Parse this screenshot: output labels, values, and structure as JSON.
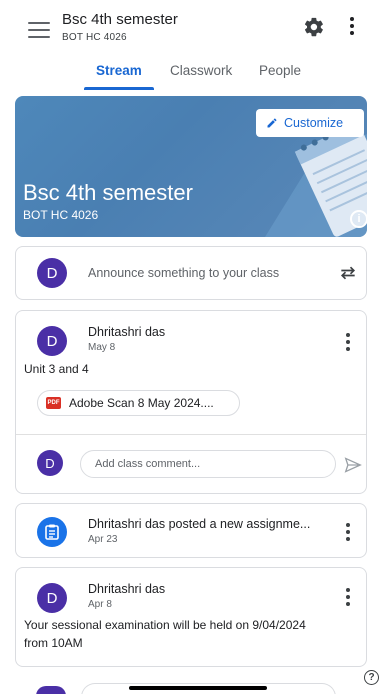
{
  "header": {
    "title": "Bsc 4th semester",
    "subtitle": "BOT HC 4026"
  },
  "tabs": [
    {
      "label": "Stream",
      "active": true
    },
    {
      "label": "Classwork",
      "active": false
    },
    {
      "label": "People",
      "active": false
    }
  ],
  "banner": {
    "title": "Bsc 4th semester",
    "subtitle": "BOT HC 4026",
    "customize_label": "Customize"
  },
  "announce": {
    "avatar_letter": "D",
    "placeholder": "Announce something to your class"
  },
  "posts": [
    {
      "avatar_letter": "D",
      "author": "Dhritashri das",
      "date": "May 8",
      "text": "Unit 3 and 4",
      "attachment": "Adobe Scan 8 May 2024....",
      "attachment_badge": "PDF",
      "comment_placeholder": "Add class comment..."
    },
    {
      "author": "Dhritashri das posted a new assignme...",
      "date": "Apr 23"
    },
    {
      "avatar_letter": "D",
      "author": "Dhritashri das",
      "date": "Apr 8",
      "text_line1": "Your sessional examination will be held on 9/04/2024",
      "text_line2": "from 10AM"
    }
  ],
  "help_label": "?",
  "colors": {
    "accent": "#1967d2",
    "avatar": "#4a2fa6",
    "banner": "#4e88ba",
    "assignment_icon": "#1a73e8",
    "pdf": "#d93025"
  }
}
